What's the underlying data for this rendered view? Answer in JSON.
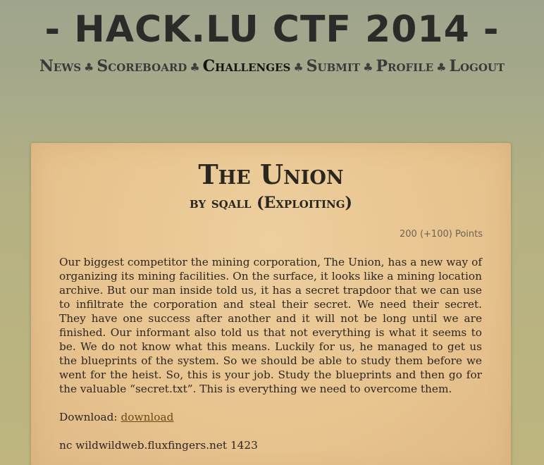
{
  "site": {
    "title": "- HACK.LU CTF 2014 -"
  },
  "nav": {
    "items": [
      {
        "label": "News"
      },
      {
        "label": "Scoreboard"
      },
      {
        "label": "Challenges"
      },
      {
        "label": "Submit"
      },
      {
        "label": "Profile"
      },
      {
        "label": "Logout"
      }
    ],
    "separator": "♣",
    "active": "Challenges"
  },
  "challenge": {
    "title": "The Union",
    "byline": "by sqall (Exploiting)",
    "points": "200 (+100) Points",
    "description": "Our biggest competitor the mining corporation, The Union, has a new way of organizing its mining facilities. On the surface, it looks like a mining location archive. But our man inside told us, it has a secret trapdoor that we can use to infiltrate the corporation and steal their secret. We need their secret. They have one success after another and it will not be long until we are finished. Our informant also told us that not everything is what it seems to be. We do not know what this means. Luckily for us, he managed to get us the blueprints of the system. So we should be able to study them before we went for the heist. So, this is your job. Study the blueprints and then go for the valuable “secret.txt”. This is everything we need to overcome them.",
    "download_label": "Download:",
    "download_link": "download",
    "netcat": "nc wildwildweb.fluxfingers.net 1423"
  }
}
